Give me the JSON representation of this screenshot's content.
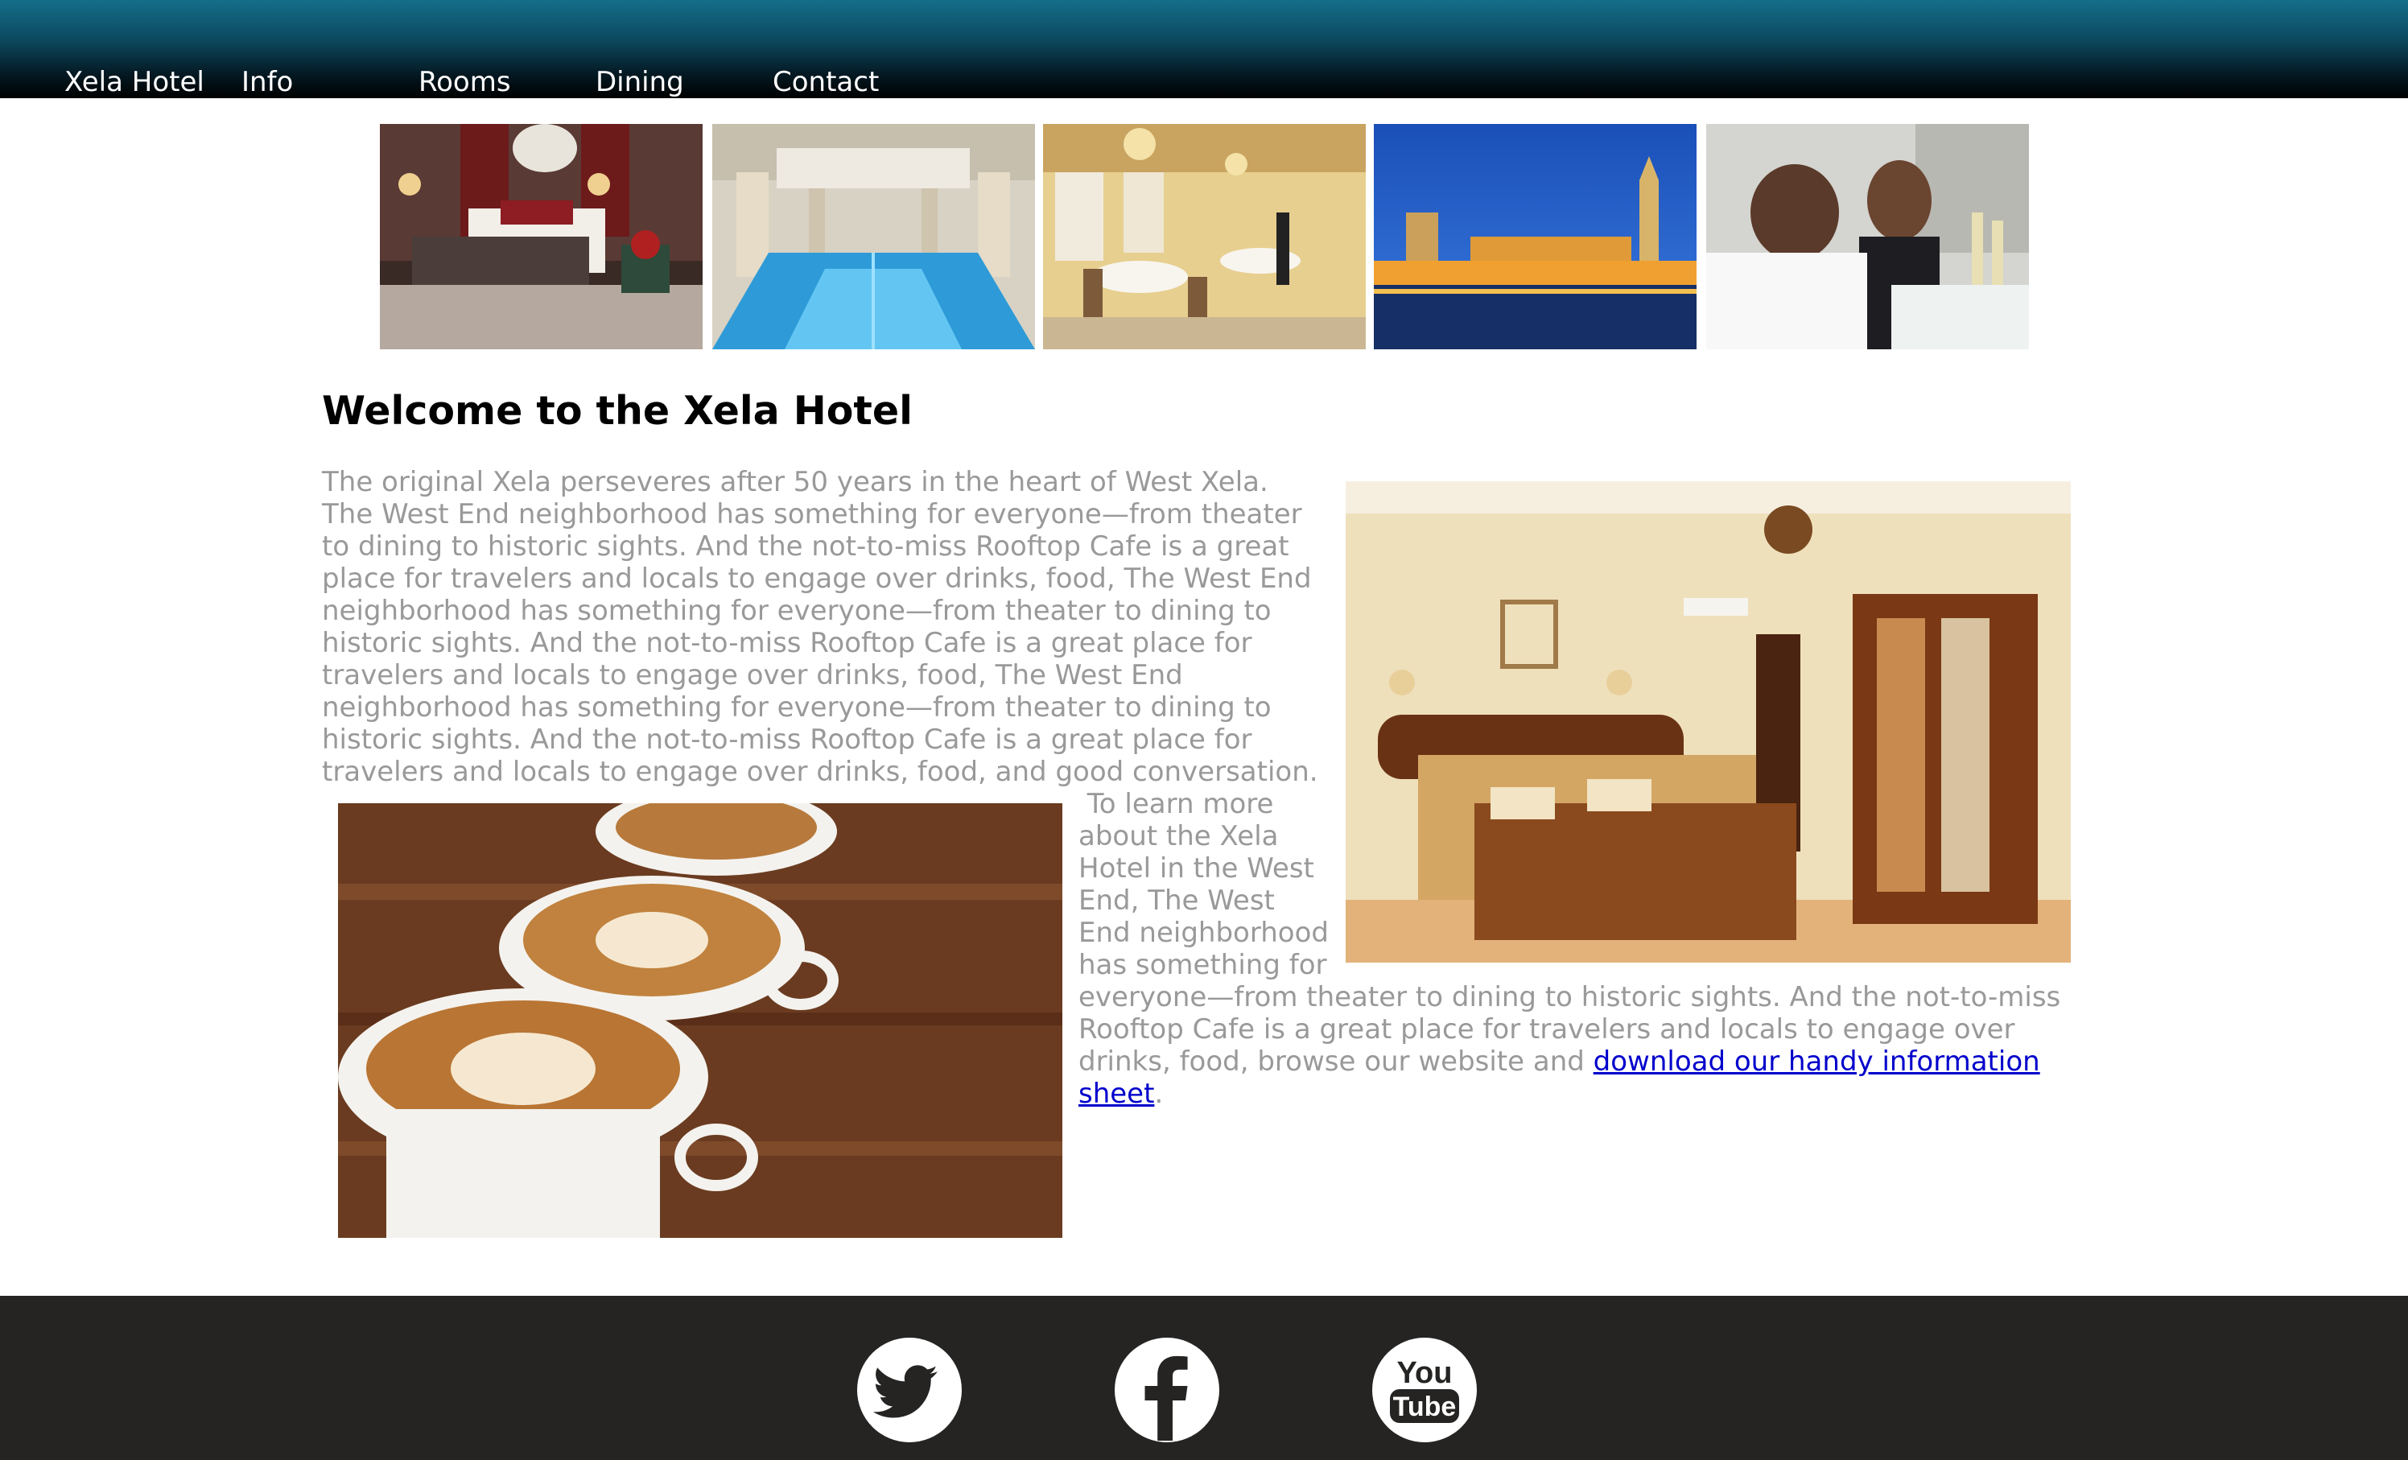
{
  "nav": {
    "brand": "Xela Hotel",
    "items": [
      "Info",
      "Rooms",
      "Dining",
      "Contact"
    ]
  },
  "gallery": {
    "icons": [
      "bedroom-photo",
      "indoor-pool-photo",
      "dining-room-photo",
      "palace-at-night-photo",
      "couple-dining-photo"
    ]
  },
  "main": {
    "title": "Welcome to the Xela Hotel",
    "lines": [
      "The original Xela perseveres after 50 years in the heart of West Xela.",
      "The West End neighborhood has something for everyone—from theater",
      "to dining to historic sights. And the not-to-miss Rooftop Cafe is a great",
      "place for travelers and locals to engage over drinks, food, The West End",
      "neighborhood has something for everyone—from theater to dining to",
      "historic sights. And the not-to-miss Rooftop Cafe is a great place for",
      "travelers and locals to engage over drinks, food, The West End",
      "neighborhood has something for everyone—from theater to dining to",
      "historic sights. And the not-to-miss Rooftop Cafe is a great place for",
      "travelers and locals to engage over drinks, food, and good  conversation."
    ],
    "narrow_lines": [
      " To learn more",
      "about the Xela",
      "Hotel in the West",
      "End, The West",
      "End neighborhood",
      "has something for"
    ],
    "wide_lines": [
      "everyone—from theater to dining to historic sights. And the not-to-miss",
      "Rooftop Cafe is a great place for travelers and locals to engage over"
    ],
    "last_line_prefix": "drinks, food, browse our website and ",
    "link_part1": "download our handy information",
    "link_part2": "sheet",
    "end_punct": ".",
    "side_photo": "hotel-bedroom-photo",
    "coffee_photo": "latte-cups-photo"
  },
  "footer": {
    "social": [
      "twitter-icon",
      "facebook-icon",
      "youtube-icon"
    ],
    "youtube_you": "You",
    "youtube_tube": "Tube"
  },
  "colors": {
    "header_top": "#146e89",
    "header_bottom": "#000000",
    "body_text": "#999999",
    "link": "#0000cc",
    "footer_bg": "#252423"
  }
}
